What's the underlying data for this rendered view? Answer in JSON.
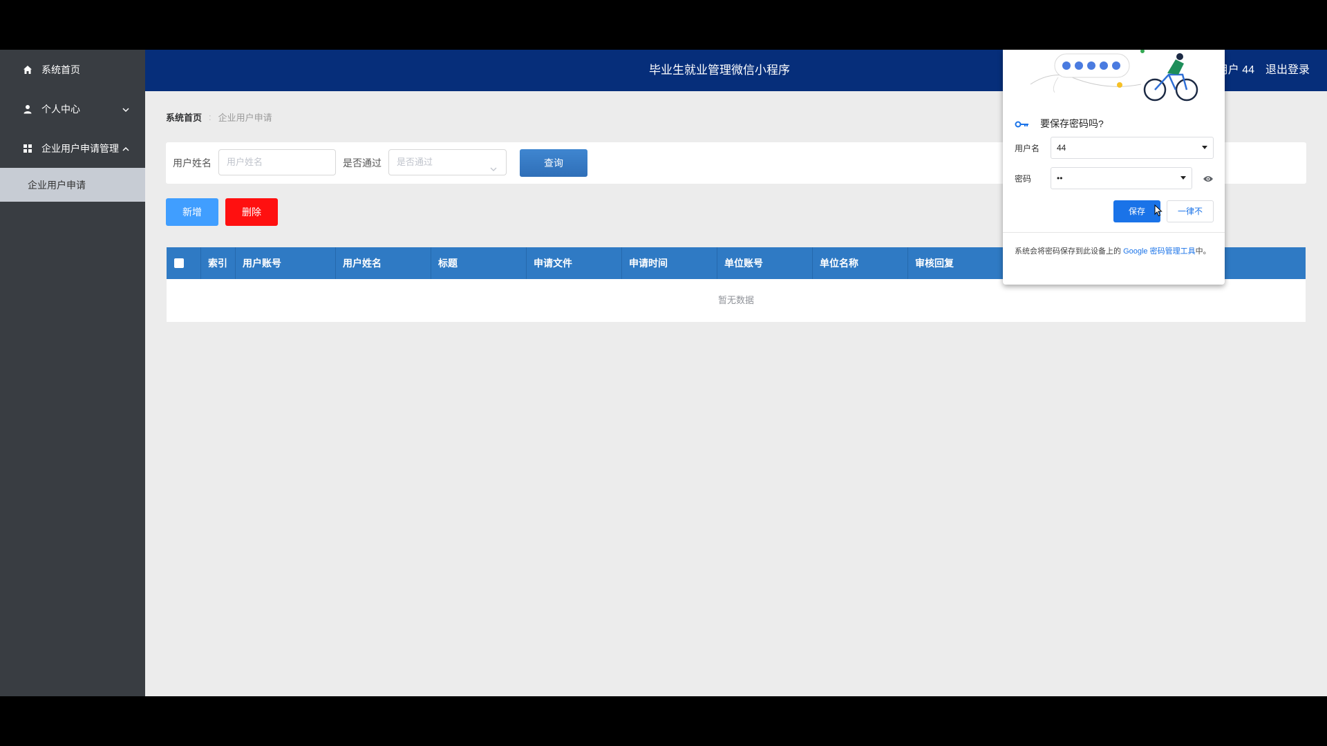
{
  "header": {
    "title": "毕业生就业管理微信小程序",
    "user_label": "用户 44",
    "logout": "退出登录"
  },
  "sidebar": {
    "items": [
      {
        "label": "系统首页",
        "icon": "home-icon"
      },
      {
        "label": "个人中心",
        "icon": "user-icon"
      },
      {
        "label": "企业用户申请管理",
        "icon": "grid-icon"
      }
    ],
    "sub_items": [
      {
        "label": "企业用户申请"
      }
    ]
  },
  "breadcrumb": {
    "home": "系统首页",
    "current": "企业用户申请"
  },
  "search": {
    "name_label": "用户姓名",
    "name_placeholder": "用户姓名",
    "passed_label": "是否通过",
    "passed_placeholder": "是否通过",
    "query_button": "查询"
  },
  "actions": {
    "add": "新增",
    "delete": "删除"
  },
  "table": {
    "columns": [
      "索引",
      "用户账号",
      "用户姓名",
      "标题",
      "申请文件",
      "申请时间",
      "单位账号",
      "单位名称",
      "审核回复"
    ],
    "empty_text": "暂无数据"
  },
  "password_popup": {
    "title": "要保存密码吗?",
    "username_label": "用户名",
    "username_value": "44",
    "password_label": "密码",
    "password_value": "••",
    "save_button": "保存",
    "never_button": "一律不",
    "footer_text": "系统会将密码保存到此设备上的 ",
    "footer_link": "Google 密码管理工具",
    "footer_end": "中。"
  },
  "colors": {
    "header_bg": "#062e7a",
    "sidebar_bg": "#393d42",
    "table_header_bg": "#2f7ac4",
    "add_button": "#409eff",
    "delete_button": "#ff1010",
    "google_blue": "#1a73e8"
  }
}
